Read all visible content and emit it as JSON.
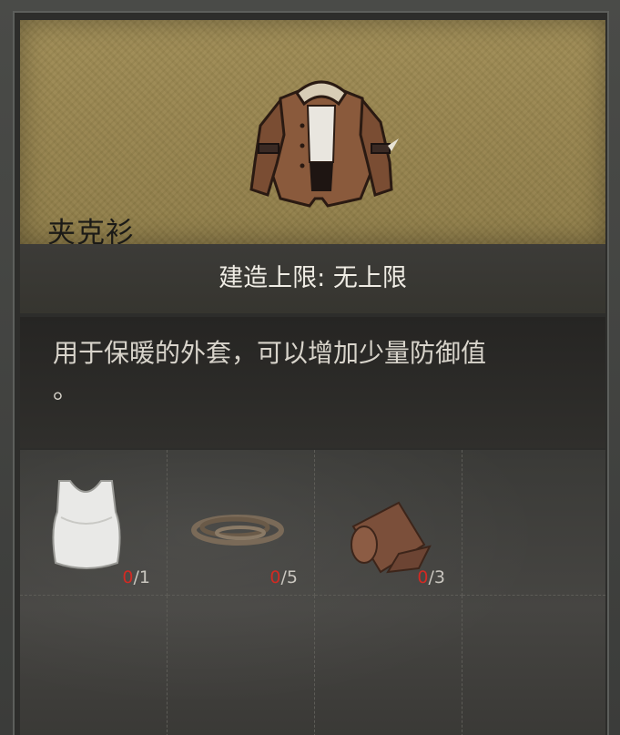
{
  "item": {
    "name": "夹克衫",
    "icon": "jacket-icon",
    "build_limit": "建造上限: 无上限",
    "description_lines": [
      "用于保暖的外套，可以增加少量防御值",
      "。"
    ]
  },
  "materials": [
    {
      "icon": "tank-top-icon",
      "have": "0",
      "need": "/1"
    },
    {
      "icon": "rope-icon",
      "have": "0",
      "need": "/5"
    },
    {
      "icon": "leather-roll-icon",
      "have": "0",
      "need": "/3"
    }
  ],
  "colors": {
    "card": "#9a8750",
    "missing": "#d12a23"
  }
}
